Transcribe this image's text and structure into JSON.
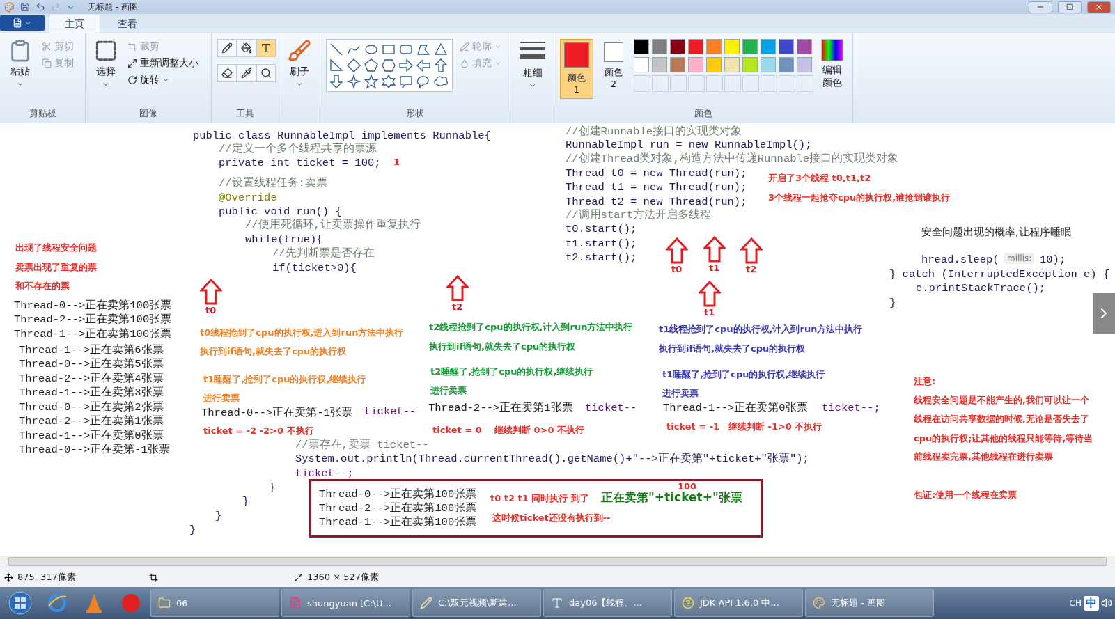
{
  "window": {
    "title": "无标题 - 画图"
  },
  "tabs": [
    {
      "label": "主页",
      "selected": true
    },
    {
      "label": "查看",
      "selected": false
    }
  ],
  "ribbon": {
    "clipboard": {
      "label": "剪贴板",
      "paste": "粘贴",
      "cut": {
        "label": "剪切",
        "disabled": true
      },
      "copy": {
        "label": "复制",
        "disabled": true
      }
    },
    "image": {
      "label": "图像",
      "select": "选择",
      "crop": {
        "label": "裁剪",
        "disabled": true
      },
      "resize": "重新调整大小",
      "rotate": "旋转"
    },
    "tools": {
      "label": "工具",
      "items": [
        {
          "kind": "pencil",
          "selected": false
        },
        {
          "kind": "fill",
          "selected": false
        },
        {
          "kind": "text",
          "selected": true
        },
        {
          "kind": "eraser",
          "selected": false
        },
        {
          "kind": "picker",
          "selected": false
        },
        {
          "kind": "magnifier",
          "selected": false
        }
      ]
    },
    "brush": "刷子",
    "shapes": {
      "label": "形状",
      "outline": {
        "label": "轮廓",
        "disabled": true
      },
      "fill": {
        "label": "填充",
        "disabled": true
      }
    },
    "size": "粗细",
    "colors": {
      "label": "颜色",
      "color1": {
        "label": "颜色 1",
        "color": "#ed1c24",
        "selected": true
      },
      "color2": {
        "label": "颜色 2",
        "color": "#ffffff",
        "selected": false
      },
      "palette": [
        {
          "color": "#000000"
        },
        {
          "color": "#7f7f7f"
        },
        {
          "color": "#880015"
        },
        {
          "color": "#ed1c24"
        },
        {
          "color": "#ff7f27"
        },
        {
          "color": "#fff200"
        },
        {
          "color": "#22b14c"
        },
        {
          "color": "#00a2e8"
        },
        {
          "color": "#3f48cc"
        },
        {
          "color": "#a349a4"
        },
        {
          "color": "#ffffff"
        },
        {
          "color": "#c3c3c3"
        },
        {
          "color": "#b97a57"
        },
        {
          "color": "#ffaec9"
        },
        {
          "color": "#ffc90e"
        },
        {
          "color": "#efe4b0"
        },
        {
          "color": "#b5e61d"
        },
        {
          "color": "#99d9ea"
        },
        {
          "color": "#7092be"
        },
        {
          "color": "#c8bfe7"
        }
      ],
      "edit": "编辑颜色"
    }
  },
  "canvas": {
    "items": [
      {
        "kind": "code",
        "text": "public class RunnableImpl implements Runnable{"
      },
      {
        "kind": "comment",
        "text": "//定义一个多个线程共享的票源"
      },
      {
        "kind": "code",
        "text": "private  int ticket = 100;"
      },
      {
        "kind": "note",
        "text": "1",
        "color": "#e8302a"
      },
      {
        "kind": "comment",
        "text": "//设置线程任务:卖票"
      },
      {
        "kind": "annotation",
        "text": "@Override"
      },
      {
        "kind": "code",
        "text": "public void run() {"
      },
      {
        "kind": "comment",
        "text": "//使用死循环,让卖票操作重复执行"
      },
      {
        "kind": "code",
        "text": "while(true){"
      },
      {
        "kind": "comment",
        "text": "//先判断票是否存在"
      },
      {
        "kind": "code",
        "text": "if(ticket>0){"
      },
      {
        "kind": "comment",
        "text": "//票存在,卖票 ticket--"
      },
      {
        "kind": "code",
        "text": "System.out.println(Thread.currentThread().getName()+\"-->正在卖第\"+ticket+\"张票\");"
      },
      {
        "kind": "field",
        "text": "ticket--;"
      },
      {
        "kind": "code",
        "text": "}"
      },
      {
        "kind": "code",
        "text": "}"
      },
      {
        "kind": "code",
        "text": "}"
      },
      {
        "kind": "code",
        "text": "}"
      },
      {
        "kind": "comment",
        "text": "//创建Runnable接口的实现类对象"
      },
      {
        "kind": "code",
        "text": "RunnableImpl run = new RunnableImpl();"
      },
      {
        "kind": "comment",
        "text": "//创建Thread类对象,构造方法中传递Runnable接口的实现类对象"
      },
      {
        "kind": "code",
        "text": "Thread t0 = new Thread(run);"
      },
      {
        "kind": "code",
        "text": "Thread t1 = new Thread(run);"
      },
      {
        "kind": "code",
        "text": "Thread t2 = new Thread(run);"
      },
      {
        "kind": "comment",
        "text": "//调用start方法开启多线程"
      },
      {
        "kind": "code",
        "text": "t0.start();"
      },
      {
        "kind": "code",
        "text": "t1.start();"
      },
      {
        "kind": "code",
        "text": "t2.start();"
      },
      {
        "kind": "plain",
        "text": "安全问题出现的概率,让程序睡眠"
      },
      {
        "kind": "code",
        "text": "hread.sleep("
      },
      {
        "kind": "hint",
        "text": "millis:"
      },
      {
        "kind": "code",
        "text": "10);"
      },
      {
        "kind": "code",
        "text": "} catch (InterruptedException e) {"
      },
      {
        "kind": "code",
        "text": "e.printStackTrace();"
      },
      {
        "kind": "code",
        "text": "}"
      },
      {
        "kind": "note",
        "text": "出现了线程安全问题",
        "color": "#e8302a"
      },
      {
        "kind": "note",
        "text": "卖票出现了重复的票",
        "color": "#e8302a"
      },
      {
        "kind": "note",
        "text": "和不存在的票",
        "color": "#e8302a"
      },
      {
        "kind": "console",
        "text": "Thread-0-->正在卖第100张票"
      },
      {
        "kind": "console",
        "text": "Thread-2-->正在卖第100张票"
      },
      {
        "kind": "console",
        "text": "Thread-1-->正在卖第100张票"
      },
      {
        "kind": "console",
        "text": "Thread-1-->正在卖第6张票"
      },
      {
        "kind": "console",
        "text": "Thread-0-->正在卖第5张票"
      },
      {
        "kind": "console",
        "text": "Thread-2-->正在卖第4张票"
      },
      {
        "kind": "console",
        "text": "Thread-1-->正在卖第3张票"
      },
      {
        "kind": "console",
        "text": "Thread-0-->正在卖第2张票"
      },
      {
        "kind": "console",
        "text": "Thread-2-->正在卖第1张票"
      },
      {
        "kind": "console",
        "text": "Thread-1-->正在卖第0张票"
      },
      {
        "kind": "console",
        "text": "Thread-0-->正在卖第-1张票"
      },
      {
        "kind": "note",
        "text": "t0线程抢到了cpu的执行权,进入到run方法中执行",
        "color": "#f07f22"
      },
      {
        "kind": "note",
        "text": "执行到if语句,就失去了cpu的执行权",
        "color": "#f07f22"
      },
      {
        "kind": "note",
        "text": "t1睡醒了,抢到了cpu的执行权,继续执行",
        "color": "#f07f22"
      },
      {
        "kind": "note",
        "text": "进行卖票",
        "color": "#f07f22"
      },
      {
        "kind": "console",
        "text": "Thread-0-->正在卖第-1张票"
      },
      {
        "kind": "field",
        "text": "ticket--"
      },
      {
        "kind": "note",
        "text": "ticket = -2  -2>0 不执行",
        "color": "#e8302a"
      },
      {
        "kind": "note",
        "text": "t2线程抢到了cpu的执行权,计入到run方法中执行",
        "color": "#1a9a3a"
      },
      {
        "kind": "note",
        "text": "执行到if语句,就失去了cpu的执行权",
        "color": "#1a9a3a"
      },
      {
        "kind": "note",
        "text": "t2睡醒了,抢到了cpu的执行权,继续执行",
        "color": "#1a9a3a"
      },
      {
        "kind": "note",
        "text": "进行卖票",
        "color": "#1a9a3a"
      },
      {
        "kind": "console",
        "text": "Thread-2-->正在卖第1张票"
      },
      {
        "kind": "field",
        "text": "ticket--"
      },
      {
        "kind": "note",
        "text": "ticket = 0",
        "color": "#e8302a"
      },
      {
        "kind": "note",
        "text": "继续判断 0>0 不执行",
        "color": "#e8302a"
      },
      {
        "kind": "note",
        "text": "t1线程抢到了cpu的执行权,计入到run方法中执行",
        "color": "#3a3ab0"
      },
      {
        "kind": "note",
        "text": "执行到if语句,就失去了cpu的执行权",
        "color": "#3a3ab0"
      },
      {
        "kind": "note",
        "text": "t1睡醒了,抢到了cpu的执行权,继续执行",
        "color": "#3a3ab0"
      },
      {
        "kind": "note",
        "text": "进行卖票",
        "color": "#3a3ab0"
      },
      {
        "kind": "console",
        "text": "Thread-1-->正在卖第0张票"
      },
      {
        "kind": "field",
        "text": "ticket--;"
      },
      {
        "kind": "note",
        "text": "ticket = -1",
        "color": "#e8302a"
      },
      {
        "kind": "note",
        "text": "继续判断 -1>0 不执行",
        "color": "#e8302a"
      },
      {
        "kind": "note",
        "text": "开启了3个线程 t0,t1,t2",
        "color": "#e8302a"
      },
      {
        "kind": "note",
        "text": "3个线程一起抢夺cpu的执行权,谁抢到谁执行",
        "color": "#e8302a"
      },
      {
        "kind": "note",
        "text": "注意:",
        "color": "#e8302a"
      },
      {
        "kind": "note",
        "text": "线程安全问题是不能产生的,我们可以让一个",
        "color": "#e8302a"
      },
      {
        "kind": "note",
        "text": "线程在访问共享数据的时候,无论是否失去了",
        "color": "#e8302a"
      },
      {
        "kind": "note",
        "text": "cpu的执行权;让其他的线程只能等待,等待当",
        "color": "#e8302a"
      },
      {
        "kind": "note",
        "text": "前线程卖完票,其他线程在进行卖票",
        "color": "#e8302a"
      },
      {
        "kind": "note",
        "text": "100",
        "color": "#e8302a"
      },
      {
        "kind": "note",
        "text": "t0 t2 t1 同时执行 到了",
        "color": "#e8302a"
      },
      {
        "kind": "bignote",
        "text": "正在卖第\"+ticket+\"张票",
        "color": "#1a7a1a"
      },
      {
        "kind": "note",
        "text": "包证:使用一个线程在卖票",
        "color": "#e8302a"
      },
      {
        "kind": "note",
        "text": "这时候ticket还没有执行到--",
        "color": "#e8302a"
      }
    ],
    "arrows": [
      {
        "label": "t0"
      },
      {
        "label": "t1"
      },
      {
        "label": "t2"
      },
      {
        "label": "t0"
      },
      {
        "label": "t2"
      },
      {
        "label": "t1"
      }
    ],
    "box": {
      "lines": [
        "Thread-0-->正在卖第100张票",
        "Thread-2-->正在卖第100张票",
        "Thread-1-->正在卖第100张票"
      ]
    }
  },
  "status_bar": {
    "cursor": "875, 317像素",
    "size": "1360 × 527像素"
  },
  "taskbar": {
    "items": [
      {
        "label": "06",
        "kind": "folder"
      },
      {
        "label": "shungyuan [C:\\U...",
        "kind": "ij"
      },
      {
        "label": "C:\\双元视频\\新建...",
        "kind": "editor"
      },
      {
        "label": "day06【线程、...",
        "kind": "doc"
      },
      {
        "label": "JDK API 1.6.0 中...",
        "kind": "help"
      },
      {
        "label": "无标题 - 画图",
        "kind": "paint"
      }
    ],
    "ime": "中",
    "lang": "CH"
  }
}
